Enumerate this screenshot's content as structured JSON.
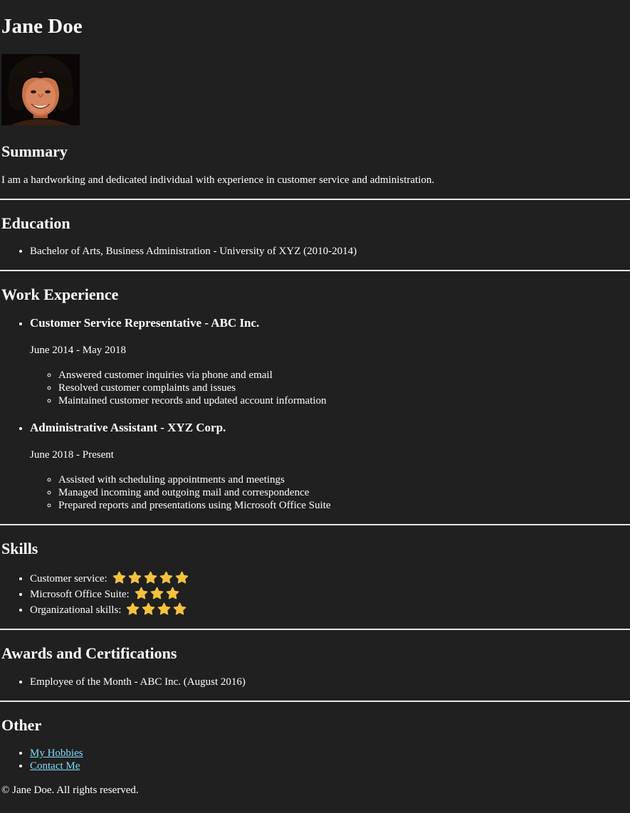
{
  "name": "Jane Doe",
  "summary": {
    "heading": "Summary",
    "text": "I am a hardworking and dedicated individual with experience in customer service and administration."
  },
  "education": {
    "heading": "Education",
    "items": [
      "Bachelor of Arts, Business Administration - University of XYZ (2010-2014)"
    ]
  },
  "work": {
    "heading": "Work Experience",
    "jobs": [
      {
        "title": "Customer Service Representative - ABC Inc.",
        "dates": "June 2014 - May 2018",
        "duties": [
          "Answered customer inquiries via phone and email",
          "Resolved customer complaints and issues",
          "Maintained customer records and updated account information"
        ]
      },
      {
        "title": "Administrative Assistant - XYZ Corp.",
        "dates": "June 2018 - Present",
        "duties": [
          "Assisted with scheduling appointments and meetings",
          "Managed incoming and outgoing mail and correspondence",
          "Prepared reports and presentations using Microsoft Office Suite"
        ]
      }
    ]
  },
  "skills": {
    "heading": "Skills",
    "items": [
      {
        "label": "Customer service:",
        "stars": 5
      },
      {
        "label": "Microsoft Office Suite:",
        "stars": 3
      },
      {
        "label": "Organizational skills:",
        "stars": 4
      }
    ],
    "star_color": "#f5c23d",
    "star_icon": "star-icon"
  },
  "awards": {
    "heading": "Awards and Certifications",
    "items": [
      "Employee of the Month - ABC Inc. (August 2016)"
    ]
  },
  "other": {
    "heading": "Other",
    "links": [
      "My Hobbies",
      "Contact Me"
    ],
    "link_color": "#7fdcff"
  },
  "footer": "© Jane Doe. All rights reserved."
}
